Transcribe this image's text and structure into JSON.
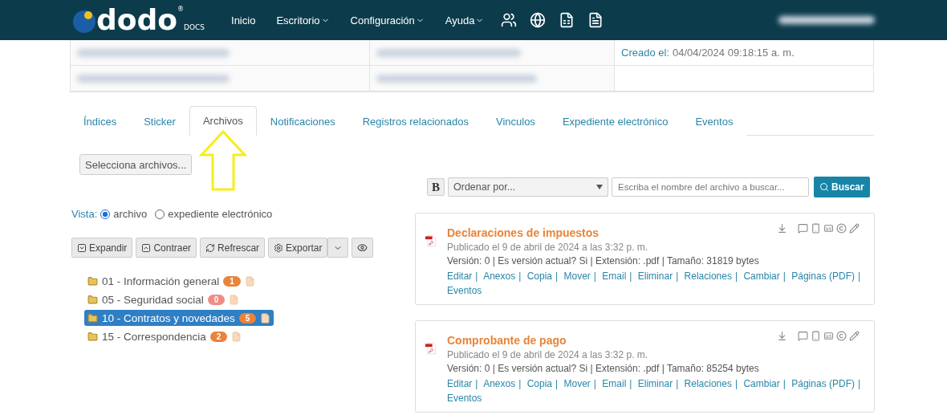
{
  "navbar": {
    "logo": {
      "word": "dodo",
      "sub": "DOCS",
      "mark": "®"
    },
    "items": [
      {
        "label": "Inicio",
        "dropdown": false
      },
      {
        "label": "Escritorio",
        "dropdown": true
      },
      {
        "label": "Configuración",
        "dropdown": true
      },
      {
        "label": "Ayuda",
        "dropdown": true
      }
    ]
  },
  "info_table": {
    "created_label": "Creado el:",
    "created_value": "04/04/2024 09:18:15 a. m."
  },
  "tabs": [
    {
      "label": "Índices",
      "selected": false
    },
    {
      "label": "Sticker",
      "selected": false
    },
    {
      "label": "Archivos",
      "selected": true
    },
    {
      "label": "Notificaciones",
      "selected": false
    },
    {
      "label": "Registros relacionados",
      "selected": false
    },
    {
      "label": "Vinculos",
      "selected": false
    },
    {
      "label": "Expediente electrónico",
      "selected": false
    },
    {
      "label": "Eventos",
      "selected": false
    }
  ],
  "select_files_button": "Selecciona archivos...",
  "view": {
    "label": "Vista:",
    "options": [
      {
        "label": "archivo",
        "selected": true
      },
      {
        "label": "expediente electrónico",
        "selected": false
      }
    ]
  },
  "tree_toolbar": [
    {
      "kind": "expand",
      "label": "Expandir"
    },
    {
      "kind": "collapse",
      "label": "Contraer"
    },
    {
      "kind": "refresh",
      "label": "Refrescar"
    },
    {
      "kind": "export",
      "label": "Exportar"
    },
    {
      "kind": "caret"
    },
    {
      "kind": "view"
    }
  ],
  "tree": [
    {
      "label": "01 - Información general",
      "count": "1",
      "color": "#e8843c",
      "selected": false
    },
    {
      "label": "05 - Seguridad social",
      "count": "0",
      "color": "#f08c84",
      "selected": false
    },
    {
      "label": "10 - Contratos y novedades",
      "count": "5",
      "color": "#e8843c",
      "selected": true
    },
    {
      "label": "15 - Correspondencia",
      "count": "2",
      "color": "#e8843c",
      "selected": false
    }
  ],
  "file_toolbar": {
    "bold_button": "B",
    "sort": {
      "value": "Ordenar por..."
    },
    "search": {
      "placeholder": "Escriba el nombre del archivo a buscar..."
    },
    "search_button": "Buscar"
  },
  "files": [
    {
      "title": "Declaraciones de impuestos",
      "published": "Publicado el 9 de abril de 2024 a las 3:32 p. m.",
      "details": "Versión: 0 | Es versión actual? Si | Extensión: .pdf | Tamaño: 31819 bytes",
      "separator": "|",
      "links": [
        "Editar",
        "Anexos",
        "Copia",
        "Mover",
        "Email",
        "Eliminar",
        "Relaciones",
        "Cambiar",
        "Páginas (PDF)",
        "Eventos"
      ]
    },
    {
      "title": "Comprobante de pago",
      "published": "Publicado el 9 de abril de 2024 a las 3:32 p. m.",
      "details": "Versión: 0 | Es versión actual? Si | Extensión: .pdf | Tamaño: 85254 bytes",
      "separator": "|",
      "links": [
        "Editar",
        "Anexos",
        "Copia",
        "Mover",
        "Email",
        "Eliminar",
        "Relaciones",
        "Cambiar",
        "Páginas (PDF)",
        "Eventos"
      ]
    }
  ]
}
